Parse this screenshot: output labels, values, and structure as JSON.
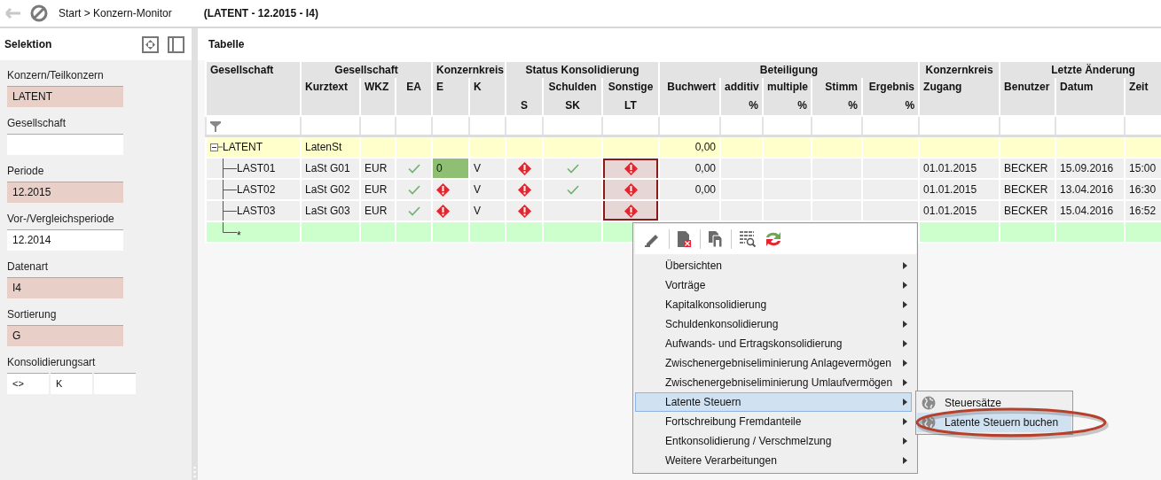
{
  "top_bar": {
    "breadcrumb": "Start > Konzern-Monitor",
    "context": "(LATENT - 12.2015 - I4)"
  },
  "sidebar": {
    "title": "Selektion",
    "fields": [
      {
        "label": "Konzern/Teilkonzern",
        "locked": true,
        "parts": [
          {
            "kind": "filled",
            "value": "LATENT"
          }
        ]
      },
      {
        "label": "Gesellschaft",
        "locked": false,
        "parts": [
          {
            "kind": "blank"
          }
        ]
      },
      {
        "label": "Periode",
        "locked": true,
        "parts": [
          {
            "kind": "filled",
            "value": "12.2015"
          }
        ]
      },
      {
        "label": "Vor-/Vergleichsperiode",
        "locked": false,
        "parts": [
          {
            "kind": "filled",
            "value": "12.2014"
          }
        ]
      },
      {
        "label": "Datenart",
        "locked": true,
        "parts": [
          {
            "kind": "filled",
            "value": "I4"
          }
        ]
      },
      {
        "label": "Sortierung",
        "locked": true,
        "parts": [
          {
            "kind": "filled",
            "value": "G"
          }
        ]
      },
      {
        "label": "Konsolidierungsart",
        "locked": false,
        "parts": [
          {
            "kind": "filled",
            "value": "<>"
          },
          {
            "kind": "filled",
            "value": "K"
          },
          {
            "kind": "blank"
          }
        ]
      }
    ]
  },
  "table": {
    "title": "Tabelle",
    "tree_column": "Gesellschaft",
    "groups": [
      {
        "label": "Gesellschaft",
        "columns": [
          {
            "label": "Kurztext"
          },
          {
            "label": "WKZ"
          },
          {
            "label": "EA"
          }
        ]
      },
      {
        "label": "Konzernkreis",
        "columns": [
          {
            "label": "E"
          },
          {
            "label": "K"
          }
        ]
      },
      {
        "label": "Status Konsolidierung",
        "columns": [
          {
            "sub": "S"
          },
          {
            "label": "Schulden",
            "sub": "SK"
          },
          {
            "label": "Sonstige",
            "sub": "LT"
          }
        ]
      },
      {
        "label": "Beteiligung",
        "columns": [
          {
            "label": "Buchwert"
          },
          {
            "label": "additiv",
            "sub": "%"
          },
          {
            "label": "multiple",
            "sub": "%"
          },
          {
            "label": "Stimm",
            "sub": "%"
          },
          {
            "label": "Ergebnis",
            "sub": "%"
          }
        ]
      },
      {
        "label": "Konzernkreis",
        "columns": [
          {
            "label": "Zugang"
          }
        ]
      },
      {
        "label": "Letzte Änderung",
        "columns": [
          {
            "label": "Benutzer"
          },
          {
            "label": "Datum"
          },
          {
            "label": "Zeit"
          }
        ]
      }
    ],
    "rows": [
      {
        "label": "LATENT",
        "kind": "group",
        "expanded": true,
        "cells": [
          {
            "kind": "text",
            "text": "LatenSt",
            "selected": false
          },
          {
            "kind": "empty",
            "selected": false
          },
          {
            "kind": "empty",
            "selected": false
          },
          {
            "kind": "empty",
            "selected": false
          },
          {
            "kind": "empty",
            "selected": false
          },
          {
            "kind": "empty",
            "selected": false
          },
          {
            "kind": "empty",
            "selected": false
          },
          {
            "kind": "empty",
            "selected": false
          },
          {
            "kind": "text",
            "text": "0,00",
            "selected": false
          },
          {
            "kind": "empty",
            "selected": false
          },
          {
            "kind": "empty",
            "selected": false
          },
          {
            "kind": "empty",
            "selected": false
          },
          {
            "kind": "empty",
            "selected": false
          },
          {
            "kind": "empty",
            "selected": false
          },
          {
            "kind": "empty",
            "selected": false
          },
          {
            "kind": "empty",
            "selected": false
          },
          {
            "kind": "empty",
            "selected": false
          }
        ],
        "children": [
          {
            "label": "LAST01",
            "kind": "item",
            "cells": [
              {
                "kind": "text",
                "text": "LaSt G01",
                "selected": false
              },
              {
                "kind": "text",
                "text": "EUR",
                "selected": false
              },
              {
                "kind": "check",
                "selected": false
              },
              {
                "kind": "marked",
                "text": "0",
                "selected": false
              },
              {
                "kind": "text",
                "text": "V",
                "selected": false
              },
              {
                "kind": "error",
                "selected": false
              },
              {
                "kind": "check",
                "selected": false
              },
              {
                "kind": "error",
                "selected": true
              },
              {
                "kind": "text",
                "text": "0,00",
                "selected": false
              },
              {
                "kind": "empty",
                "selected": false
              },
              {
                "kind": "empty",
                "selected": false
              },
              {
                "kind": "empty",
                "selected": false
              },
              {
                "kind": "empty",
                "selected": false
              },
              {
                "kind": "text",
                "text": "01.01.2015",
                "selected": false
              },
              {
                "kind": "text",
                "text": "BECKER",
                "selected": false
              },
              {
                "kind": "text",
                "text": "15.09.2016",
                "selected": false
              },
              {
                "kind": "text",
                "text": "15:00",
                "selected": false
              }
            ]
          },
          {
            "label": "LAST02",
            "kind": "item",
            "cells": [
              {
                "kind": "text",
                "text": "LaSt G02",
                "selected": false
              },
              {
                "kind": "text",
                "text": "EUR",
                "selected": false
              },
              {
                "kind": "check",
                "selected": false
              },
              {
                "kind": "error",
                "selected": false
              },
              {
                "kind": "text",
                "text": "V",
                "selected": false
              },
              {
                "kind": "error",
                "selected": false
              },
              {
                "kind": "check",
                "selected": false
              },
              {
                "kind": "error",
                "selected": true
              },
              {
                "kind": "text",
                "text": "0,00",
                "selected": false
              },
              {
                "kind": "empty",
                "selected": false
              },
              {
                "kind": "empty",
                "selected": false
              },
              {
                "kind": "empty",
                "selected": false
              },
              {
                "kind": "empty",
                "selected": false
              },
              {
                "kind": "text",
                "text": "01.01.2015",
                "selected": false
              },
              {
                "kind": "text",
                "text": "BECKER",
                "selected": false
              },
              {
                "kind": "text",
                "text": "13.04.2016",
                "selected": false
              },
              {
                "kind": "text",
                "text": "16:30",
                "selected": false
              }
            ]
          },
          {
            "label": "LAST03",
            "kind": "item",
            "cells": [
              {
                "kind": "text",
                "text": "LaSt G03",
                "selected": false
              },
              {
                "kind": "text",
                "text": "EUR",
                "selected": false
              },
              {
                "kind": "check",
                "selected": false
              },
              {
                "kind": "error",
                "selected": false
              },
              {
                "kind": "text",
                "text": "V",
                "selected": false
              },
              {
                "kind": "error",
                "selected": false
              },
              {
                "kind": "empty",
                "selected": false
              },
              {
                "kind": "error",
                "selected": true
              },
              {
                "kind": "empty",
                "selected": false
              },
              {
                "kind": "empty",
                "selected": false
              },
              {
                "kind": "empty",
                "selected": false
              },
              {
                "kind": "empty",
                "selected": false
              },
              {
                "kind": "empty",
                "selected": false
              },
              {
                "kind": "text",
                "text": "01.01.2015",
                "selected": false
              },
              {
                "kind": "text",
                "text": "BECKER",
                "selected": false
              },
              {
                "kind": "text",
                "text": "15.04.2016",
                "selected": false
              },
              {
                "kind": "text",
                "text": "16:52",
                "selected": false
              }
            ]
          },
          {
            "label": "*",
            "kind": "new"
          }
        ]
      }
    ]
  },
  "context_menu": {
    "items": [
      {
        "label": "Übersichten",
        "has_submenu": true,
        "selected": false
      },
      {
        "label": "Vorträge",
        "has_submenu": true,
        "selected": false
      },
      {
        "label": "Kapitalkonsolidierung",
        "has_submenu": true,
        "selected": false
      },
      {
        "label": "Schuldenkonsolidierung",
        "has_submenu": true,
        "selected": false
      },
      {
        "label": "Aufwands- und Ertragskonsolidierung",
        "has_submenu": true,
        "selected": false
      },
      {
        "label": "Zwischenergebniseliminierung Anlagevermögen",
        "has_submenu": true,
        "selected": false
      },
      {
        "label": "Zwischenergebniseliminierung Umlaufvermögen",
        "has_submenu": true,
        "selected": false
      },
      {
        "label": "Latente Steuern",
        "has_submenu": true,
        "selected": true,
        "submenu": [
          {
            "label": "Steuersätze",
            "selected": false,
            "annotated": false
          },
          {
            "label": "Latente Steuern buchen",
            "selected": true,
            "annotated": true
          }
        ]
      },
      {
        "label": "Fortschreibung Fremdanteile",
        "has_submenu": true,
        "selected": false
      },
      {
        "label": "Entkonsolidierung / Verschmelzung",
        "has_submenu": true,
        "selected": false
      },
      {
        "label": "Weitere Verarbeitungen",
        "has_submenu": true,
        "selected": false
      }
    ]
  }
}
